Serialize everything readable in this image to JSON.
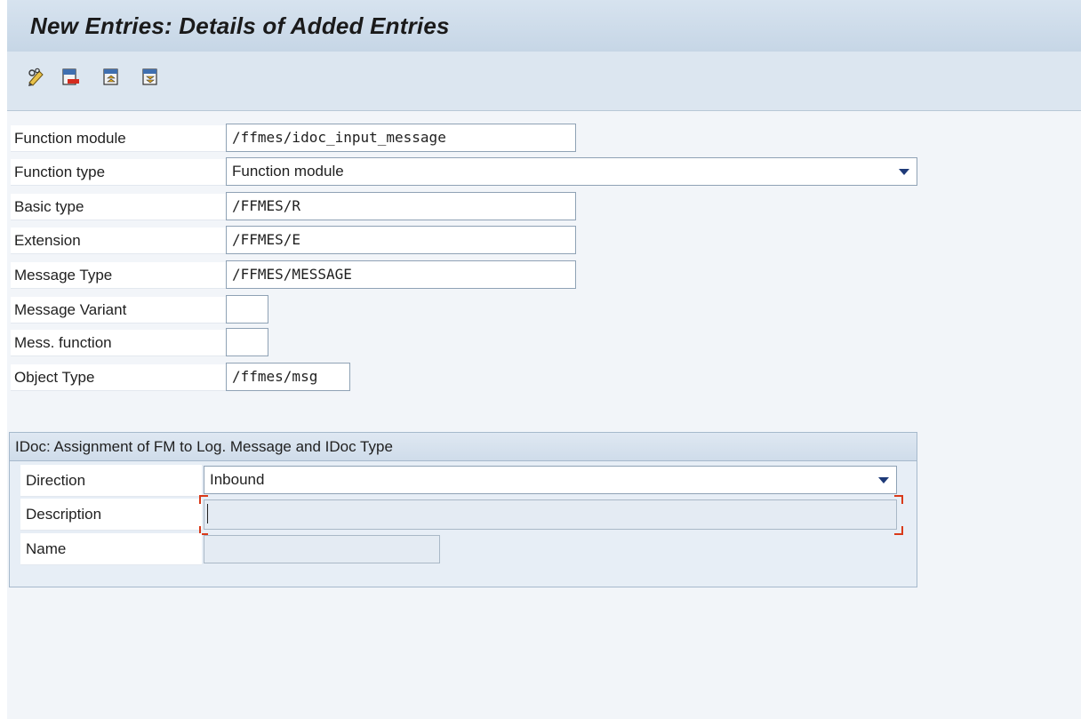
{
  "window": {
    "title": "New Entries: Details of Added Entries"
  },
  "toolbar": {
    "icons": [
      "display-change-icon",
      "delete-entry-icon",
      "previous-entry-icon",
      "next-entry-icon"
    ]
  },
  "form": {
    "function_module": {
      "label": "Function module",
      "value": "/ffmes/idoc_input_message"
    },
    "function_type": {
      "label": "Function type",
      "value": "Function module"
    },
    "basic_type": {
      "label": "Basic type",
      "value": "/FFMES/R"
    },
    "extension": {
      "label": "Extension",
      "value": "/FFMES/E"
    },
    "message_type": {
      "label": "Message Type",
      "value": "/FFMES/MESSAGE"
    },
    "message_variant": {
      "label": "Message Variant",
      "value": ""
    },
    "mess_function": {
      "label": "Mess. function",
      "value": ""
    },
    "object_type": {
      "label": "Object Type",
      "value": "/ffmes/msg"
    }
  },
  "group": {
    "title": "IDoc: Assignment of FM to Log. Message and IDoc Type",
    "direction": {
      "label": "Direction",
      "value": "Inbound"
    },
    "description": {
      "label": "Description",
      "value": ""
    },
    "name": {
      "label": "Name",
      "value": ""
    }
  },
  "colors": {
    "title_bar": "#c6d6e6",
    "toolbar": "#dce6f0",
    "focus": "#d93a1a",
    "dropdown_arrow": "#1e3a78"
  }
}
